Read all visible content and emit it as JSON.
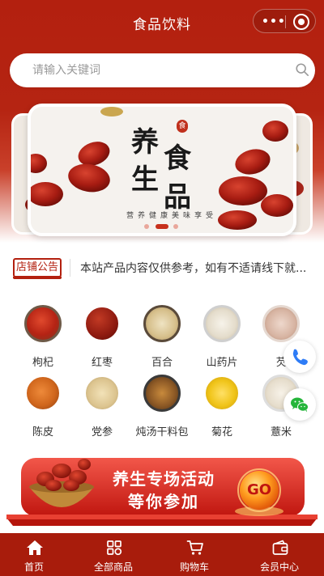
{
  "navbar": {
    "title": "食品饮料",
    "more_icon": "more-dots-icon",
    "close_icon": "capsule-target-icon"
  },
  "search": {
    "placeholder": "请输入关键词",
    "icon": "search-icon"
  },
  "banner": {
    "headline_chars": [
      "养",
      "食",
      "生",
      "品"
    ],
    "seal_text": "食",
    "tagline": "营养健康美味享受",
    "slide_count": 3,
    "active_slide": 2
  },
  "notice": {
    "badge": "店铺公告",
    "text": "本站产品内容仅供参考，如有不适请线下就..."
  },
  "categories": [
    {
      "label": "枸杞",
      "color": "#c8321e"
    },
    {
      "label": "红枣",
      "color": "#9b1f14"
    },
    {
      "label": "百合",
      "color": "#d9c79c"
    },
    {
      "label": "山药片",
      "color": "#e8e2d4"
    },
    {
      "label": "芡",
      "color": "#d9b9a8"
    },
    {
      "label": "陈皮",
      "color": "#d9732a"
    },
    {
      "label": "党参",
      "color": "#e3cfa0"
    },
    {
      "label": "炖汤干料包",
      "color": "#8a5a2c"
    },
    {
      "label": "菊花",
      "color": "#f0c419"
    },
    {
      "label": "薏米",
      "color": "#efe8dc"
    }
  ],
  "float_buttons": [
    {
      "icon": "phone-icon",
      "color": "#2e7cf6"
    },
    {
      "icon": "wechat-icon",
      "color": "#24b53a"
    }
  ],
  "promo": {
    "line1": "养生专场活动",
    "line2": "等你参加",
    "go": "GO"
  },
  "tabbar": [
    {
      "label": "首页",
      "icon": "home-icon"
    },
    {
      "label": "全部商品",
      "icon": "grid-icon"
    },
    {
      "label": "购物车",
      "icon": "cart-icon"
    },
    {
      "label": "会员中心",
      "icon": "wallet-icon"
    }
  ],
  "colors": {
    "brand": "#b3200f",
    "tabbar": "#a81c0c"
  }
}
